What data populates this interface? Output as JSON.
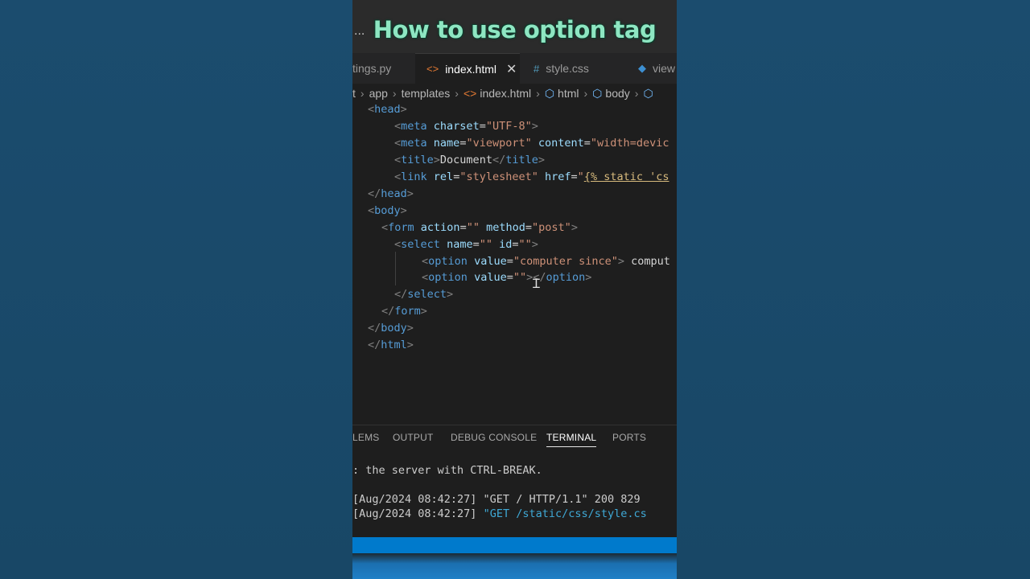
{
  "caption": "How to use option tag",
  "topbar": {
    "menu_dots": "..."
  },
  "tabs": [
    {
      "label": "tings.py",
      "icon": "python-file-icon",
      "active": false
    },
    {
      "label": "index.html",
      "icon": "html-file-icon",
      "active": true
    },
    {
      "label": "style.css",
      "icon": "css-file-icon",
      "active": false
    },
    {
      "label": "view",
      "icon": "python-file-icon",
      "active": false
    }
  ],
  "tab_close_glyph": "✕",
  "breadcrumb": [
    "t",
    "app",
    "templates",
    "index.html",
    "html",
    "body"
  ],
  "code_lines": [
    "<head>",
    "<meta charset=\"UTF-8\">",
    "<meta name=\"viewport\" content=\"width=devic",
    "<title>Document</title>",
    "<link rel=\"stylesheet\" href=\"{% static 'cs",
    "</head>",
    "<body>",
    "<form action=\"\" method=\"post\">",
    "<select name=\"\" id=\"\">",
    "<option value=\"computer since\"> comput",
    "<option value=\"\"></option>",
    "</select>",
    "</form>",
    "</body>",
    "</html>"
  ],
  "panel_tabs": [
    {
      "label": "LEMS",
      "active": false
    },
    {
      "label": "OUTPUT",
      "active": false
    },
    {
      "label": "DEBUG CONSOLE",
      "active": false
    },
    {
      "label": "TERMINAL",
      "active": true
    },
    {
      "label": "PORTS",
      "active": false
    }
  ],
  "terminal": {
    "line1": ": the server with CTRL-BREAK.",
    "line2": "[Aug/2024 08:42:27] \"GET / HTTP/1.1\" 200 829",
    "line3_prefix": "[Aug/2024 08:42:27] ",
    "line3_highlight": "\"GET /static/css/style.cs"
  },
  "colors": {
    "caption": "#8ee6c2",
    "tag": "#569cd6",
    "attribute": "#9cdcfe",
    "string": "#ce9178",
    "statusbar": "#007acc",
    "background": "#1a4a6c"
  }
}
